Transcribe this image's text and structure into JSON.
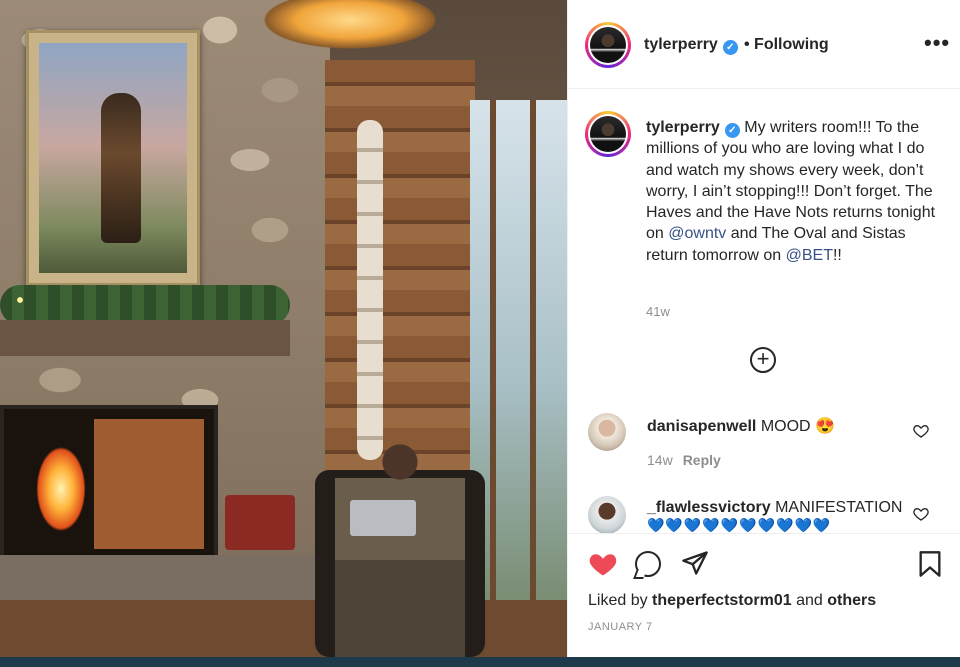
{
  "post": {
    "username": "tylerperry",
    "verified_mark": "✓",
    "following_label": "• Following",
    "more_icon": "more-horizontal-icon",
    "caption": {
      "username": "tylerperry",
      "text_1": " My writers room!!! To the millions of you who are loving what I do and watch my shows every week, don’t worry, I ain’t stopping!!! Don’t forget. The Haves and the Have Nots returns tonight on ",
      "mention_1": "@owntv",
      "text_2": " and The Oval and Sistas return tomorrow on ",
      "mention_2": "@BET",
      "text_3": "!!"
    },
    "caption_time": "41w",
    "load_more_icon": "⊕"
  },
  "comments": [
    {
      "username": "danisapenwell",
      "text": "MOOD 😍",
      "time": "14w",
      "reply_label": "Reply"
    },
    {
      "username": "_flawlessvictory",
      "text": "MANIFESTATION",
      "hearts": "💙💙💙💙💙💙💙💙💙💙"
    }
  ],
  "actions": {
    "liked_prefix": "Liked by ",
    "liked_user": "theperfectstorm01",
    "liked_and": " and ",
    "liked_others": "others",
    "date": "JANUARY 7",
    "like_glyph": "♥",
    "share_glyph": "➢"
  },
  "colors": {
    "like_red": "#ed4956",
    "verified_blue": "#3897f0",
    "link_blue": "#385185",
    "muted_grey": "#8e8e8e"
  }
}
